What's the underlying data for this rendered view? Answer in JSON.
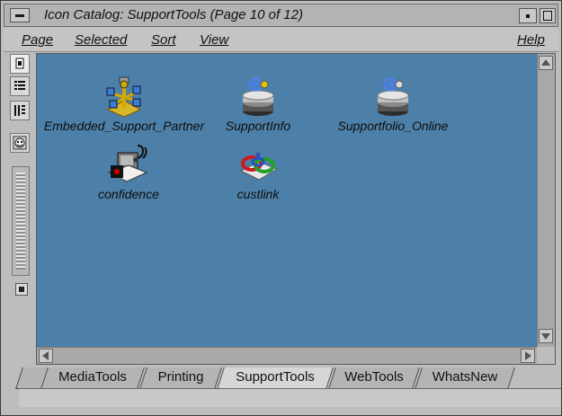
{
  "window": {
    "title": "Icon Catalog: SupportTools (Page 10 of 12)"
  },
  "menubar": {
    "items": [
      {
        "label": "Page"
      },
      {
        "label": "Selected"
      },
      {
        "label": "Sort"
      },
      {
        "label": "View"
      }
    ],
    "help": "Help"
  },
  "icons": [
    {
      "label": "Embedded_Support_Partner",
      "icon": "partner-icon"
    },
    {
      "label": "SupportInfo",
      "icon": "web-stack-icon"
    },
    {
      "label": "Supportfolio_Online",
      "icon": "web-stack-icon"
    },
    {
      "label": "confidence",
      "icon": "stethoscope-icon"
    },
    {
      "label": "custlink",
      "icon": "link-icon"
    }
  ],
  "tabs": [
    {
      "label": "MediaTools"
    },
    {
      "label": "Printing"
    },
    {
      "label": "SupportTools",
      "active": true
    },
    {
      "label": "WebTools"
    },
    {
      "label": "WhatsNew"
    }
  ],
  "colors": {
    "canvas": "#4d80a8",
    "chrome": "#bdbdbd"
  }
}
